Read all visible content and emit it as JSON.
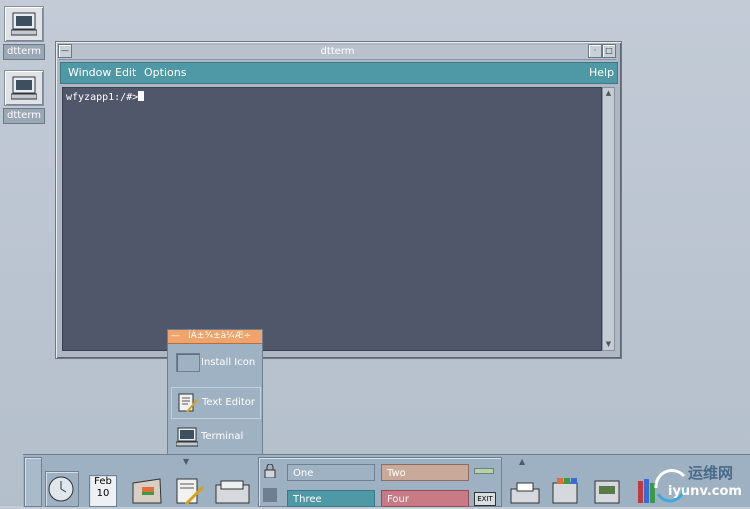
{
  "desktop": {
    "icons": [
      {
        "label": "dtterm",
        "icon": "terminal-icon"
      },
      {
        "label": "dtterm",
        "icon": "terminal-icon"
      }
    ]
  },
  "window": {
    "title": "dtterm",
    "menu": {
      "window": "Window",
      "edit": "Edit",
      "options": "Options",
      "help": "Help"
    },
    "terminal": {
      "prompt": "wfyzapp1:/#>"
    }
  },
  "subpanel": {
    "title": "ÍÁ±¾±à¼­Æ÷",
    "items": [
      {
        "label": "Install Icon",
        "icon": "install-icon"
      },
      {
        "label": "Text Editor",
        "icon": "text-editor-icon"
      },
      {
        "label": "Terminal",
        "icon": "terminal-icon"
      }
    ]
  },
  "front_panel": {
    "date": {
      "month": "Feb",
      "day": "10"
    },
    "workspaces": [
      "One",
      "Two",
      "Three",
      "Four"
    ],
    "exit_label": "EXIT"
  },
  "watermark": {
    "text_cn": "运维网",
    "text_url": "iyunv.com"
  },
  "colors": {
    "menubar": "#4f98a6",
    "terminal_bg": "#51576a",
    "subpanel_title": "#f0a36a",
    "ws_one": "#9fb2c3",
    "ws_two": "#c9a99a",
    "ws_three": "#4f98a6",
    "ws_four": "#c97a85"
  }
}
